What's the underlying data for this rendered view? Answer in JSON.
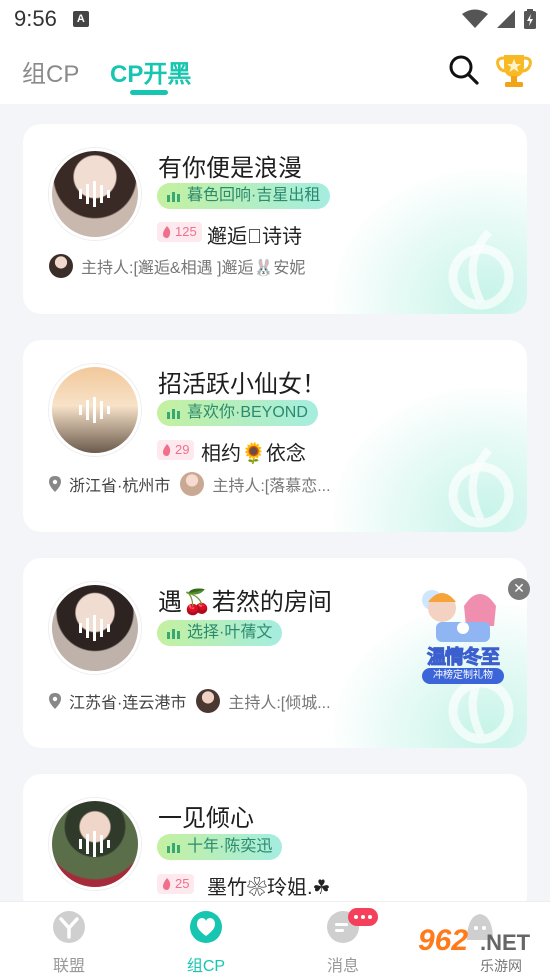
{
  "status_bar": {
    "time": "9:56",
    "notification_icon": "a-icon"
  },
  "header": {
    "tabs": [
      {
        "label": "组CP",
        "active": false
      },
      {
        "label": "CP开黑",
        "active": true
      }
    ],
    "search_icon": "search-icon",
    "trophy_icon": "trophy-icon"
  },
  "rooms": [
    {
      "title": "有你便是浪漫",
      "song": "暮色回响·吉星出租",
      "hot": "125",
      "host": "邂逅\u0000诗诗",
      "location": "",
      "host_line": "主持人:[邂逅&相遇 ]邂逅🐰安妮"
    },
    {
      "title": "招活跃小仙女！",
      "song": "喜欢你·BEYOND",
      "hot": "29",
      "host": "相约🌻依念",
      "location": "浙江省·杭州市",
      "host_line": "主持人:[落慕恋..."
    },
    {
      "title": "遇🍒若然的房间",
      "song": "选择·叶蒨文",
      "hot": "",
      "host": "",
      "location": "江苏省·连云港市",
      "host_line": "主持人:[倾城..."
    },
    {
      "title": "一见倾心",
      "song": "十年·陈奕迅",
      "hot": "25",
      "host": "墨竹❀玲姐.☘",
      "location": "",
      "host_line": ""
    }
  ],
  "promo": {
    "title": "温情冬至",
    "subtitle": "冲榜定制礼物",
    "close": "✕"
  },
  "bottom_nav": [
    {
      "label": "联盟",
      "active": false
    },
    {
      "label": "组CP",
      "active": true
    },
    {
      "label": "消息",
      "active": false
    },
    {
      "label": "",
      "active": false
    }
  ],
  "watermark": {
    "number": "962",
    "net": ".NET",
    "sub": "乐游网"
  },
  "colors": {
    "accent": "#16c6b0",
    "badge": "#f4405a",
    "hot_text": "#f0708c"
  }
}
